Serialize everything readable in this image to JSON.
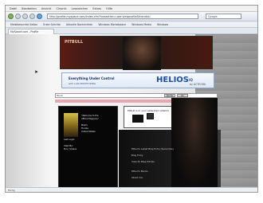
{
  "browser": {
    "menu": [
      "Datei",
      "Bearbeiten",
      "Ansicht",
      "Chronik",
      "Lesezeichen",
      "Extras",
      "Hilfe"
    ],
    "url": "http://profile.myspace.com/index.cfm?fuseaction=user.viewprofile&friendid=",
    "search_placeholder": "Google",
    "bookmarks": [
      "Meistbesuchte Seiten",
      "Erste Schritte",
      "Aktuelle Nachrichten",
      "Windows Marketplace",
      "Windows Media",
      "Windows"
    ],
    "tab_label": "MySpace.com - Profile"
  },
  "page": {
    "banner_title": "PITBULL",
    "ad": {
      "headline": "Everything Under Control",
      "subline": "with LAN-MONITORING",
      "brand": "HELIOS",
      "brand_suffix": "IQ",
      "vendor": "by ACTEGRA"
    },
    "search_field_value": "Musik",
    "search_buttons": [
      "Suche",
      "Go"
    ],
    "left_panel": {
      "lines": [
        "\"Welcome to the",
        "official Myspace\"",
        "",
        "Miami",
        "Florida",
        "United States",
        "",
        "Last Login:",
        "",
        "View My:",
        "Pics | Videos"
      ]
    },
    "right_box": {
      "heading": "Pitbull is in your extended network"
    },
    "dark_lines": [
      "Pitbull's Latest Blog Entry [Subscribe]",
      "",
      "Blog Entry",
      "",
      "View All Blog Entries",
      "",
      "Pitbull's Blurbs",
      "",
      "About me:"
    ],
    "status": "Fertig"
  },
  "colors": {
    "accent_ad": "#1d4ea5",
    "strip": "#e7a7ac",
    "banner": "#5a1c15"
  }
}
